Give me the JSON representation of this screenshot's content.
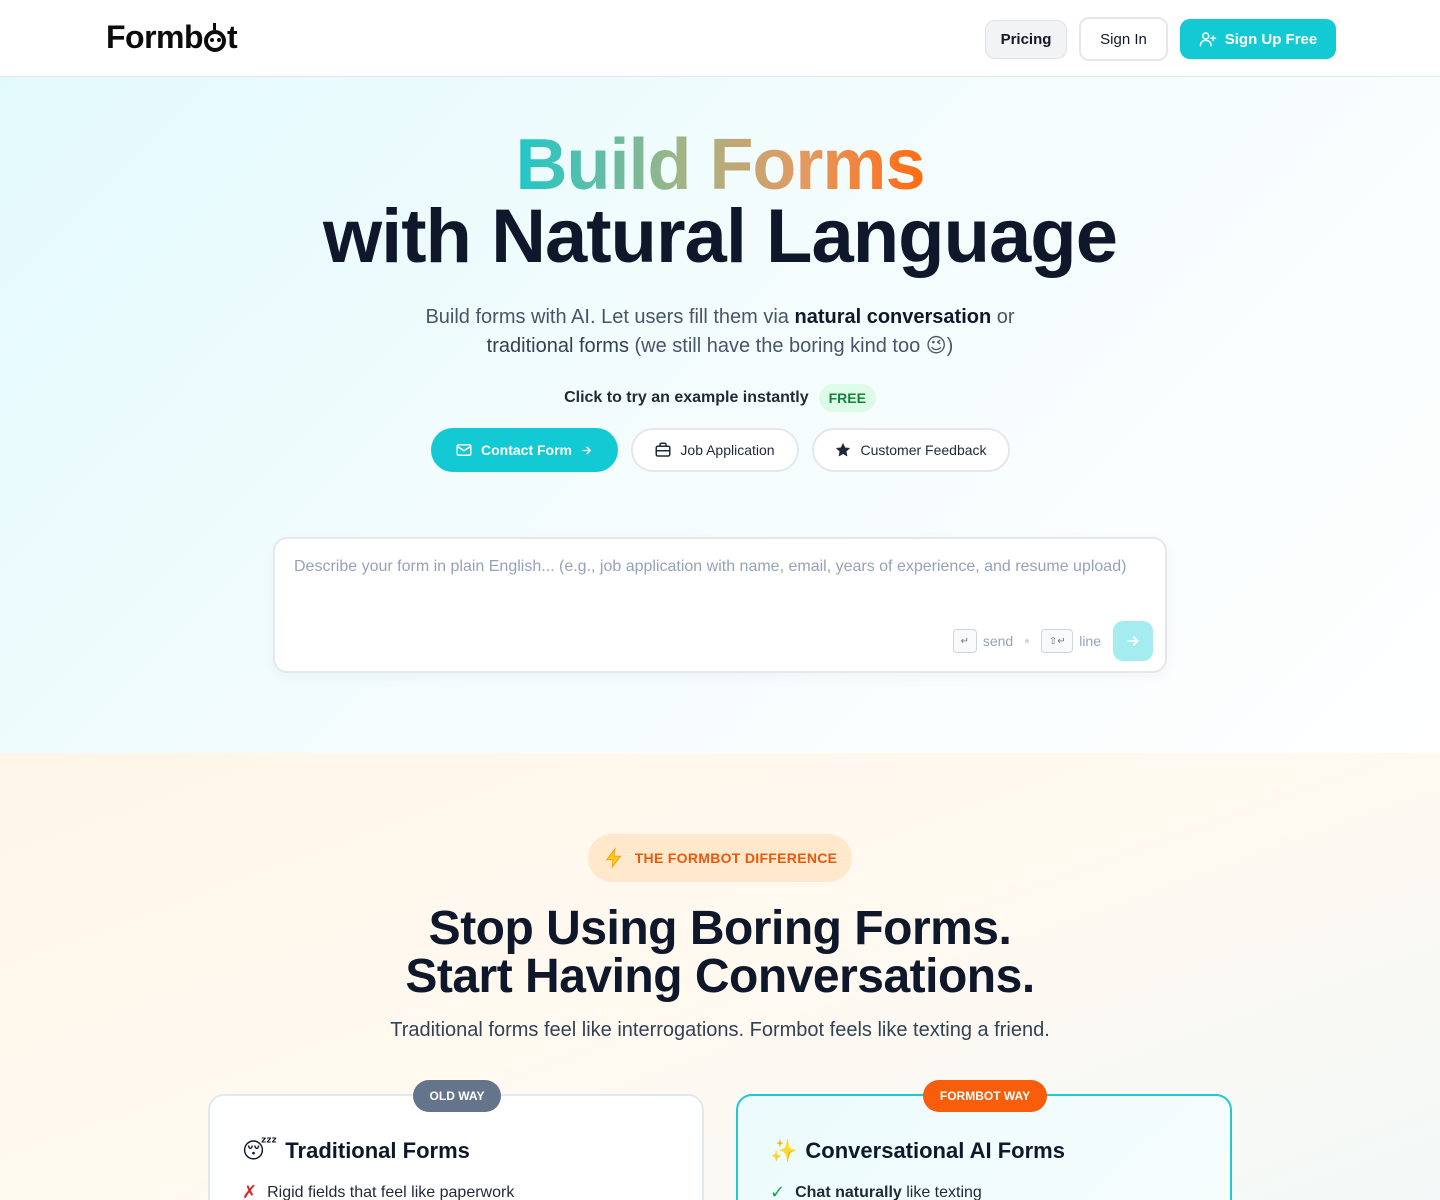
{
  "header": {
    "logo_prefix": "Formb",
    "logo_suffix": "t",
    "pricing_label": "Pricing",
    "signin_label": "Sign In",
    "signup_label": "Sign Up Free"
  },
  "hero": {
    "title_gradient": "Build Forms",
    "title_main": "with Natural Language",
    "subtitle_part1": "Build forms with AI. Let users fill them via ",
    "subtitle_bold": "natural conversation",
    "subtitle_part2": " or",
    "subtitle_part3": "traditional forms",
    "subtitle_part4": " (we still have the boring kind too ",
    "subtitle_emoji": "😉",
    "subtitle_part5": ")",
    "try_label": "Click to try an example instantly",
    "free_badge": "FREE",
    "examples": [
      {
        "label": "Contact Form"
      },
      {
        "label": "Job Application"
      },
      {
        "label": "Customer Feedback"
      }
    ],
    "composer": {
      "placeholder": "Describe your form in plain English... (e.g., job application with name, email, years of experience, and resume upload)",
      "send_key": "↵",
      "send_hint": "send",
      "line_key": "⇧↵",
      "line_hint": "line"
    }
  },
  "difference": {
    "badge": "THE FORMBOT DIFFERENCE",
    "title_line1": "Stop Using Boring Forms.",
    "title_line2": "Start Having Conversations.",
    "subtitle": "Traditional forms feel like interrogations. Formbot feels like texting a friend.",
    "cards": [
      {
        "tag": "OLD WAY",
        "emoji": "😴",
        "title": "Traditional Forms",
        "item_mark": "✗",
        "item": "Rigid fields that feel like paperwork"
      },
      {
        "tag": "FORMBOT WAY",
        "emoji": "✨",
        "title": "Conversational AI Forms",
        "item_mark": "✓",
        "item_bold": "Chat naturally",
        "item": " like texting"
      }
    ]
  },
  "colors": {
    "accent": "#12c9d4",
    "orange": "#f75d0a",
    "text_dark": "#0f172a"
  }
}
